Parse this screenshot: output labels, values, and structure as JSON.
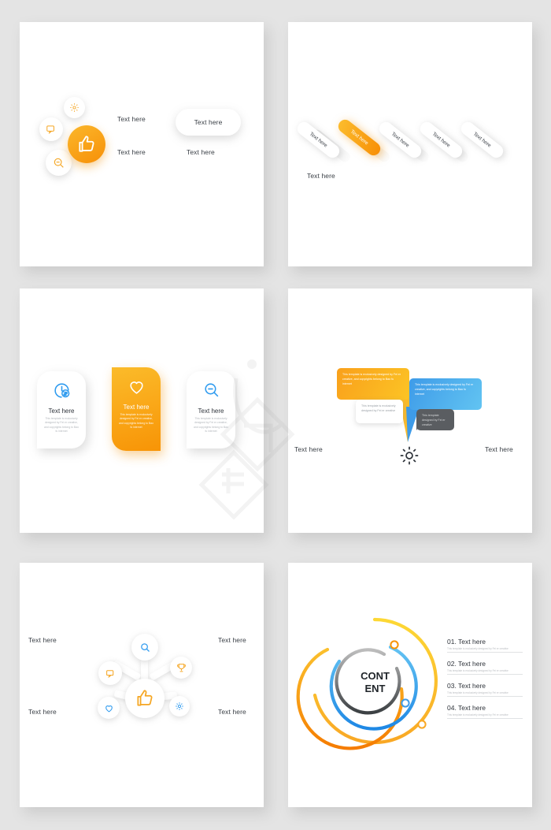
{
  "meta": {
    "background_color": "#e4e4e4",
    "panel_color": "#ffffff",
    "accent_orange": "#F79008",
    "accent_orange_light": "#FBBB2A",
    "accent_blue": "#3E9BE8",
    "accent_blue_light": "#62C4F2",
    "accent_grey": "#5a5d61",
    "text_color": "#3b4047"
  },
  "strings": {
    "text_here": "Text here",
    "body_long": "This template is exclusively designed by Fei er creative, and copyrights belong to Bao fu internet",
    "body_short": "This template is exclusively designed by Fei er creative",
    "body_tiny": "This template designed by Fei er creative",
    "content_line1": "CONT",
    "content_line2": "ENT"
  },
  "panel1": {
    "name": "circle-cluster-infographic",
    "icons": [
      {
        "id": "gear-icon",
        "label": "gear"
      },
      {
        "id": "comment-icon",
        "label": "comment"
      },
      {
        "id": "zoom-out-icon",
        "label": "zoom-out"
      },
      {
        "id": "thumbs-up-icon",
        "label": "thumbs-up"
      }
    ],
    "labels": [
      "Text here",
      "Text here",
      "Text here",
      "Text here"
    ],
    "button_label": "Text here"
  },
  "panel2": {
    "name": "diagonal-pills-infographic",
    "pills": [
      {
        "label": "Text here",
        "active": false
      },
      {
        "label": "Text here",
        "active": true
      },
      {
        "label": "Text here",
        "active": false
      },
      {
        "label": "Text here",
        "active": false
      },
      {
        "label": "Text here",
        "active": false
      }
    ],
    "caption": "Text here"
  },
  "panel3": {
    "name": "leaf-cards-infographic",
    "cards": [
      {
        "icon": "clock-dollar-icon",
        "title": "Text here",
        "body": "This template is exclusively designed by Fei er creative, and copyrights belong to Bao fu internet",
        "active": false
      },
      {
        "icon": "heart-icon",
        "title": "Text here",
        "body": "This template is exclusively designed by Fei er creative, and copyrights belong to Bao fu internet",
        "active": true
      },
      {
        "icon": "zoom-out-icon",
        "title": "Text here",
        "body": "This template is exclusively designed by Fei er creative, and copyrights belong to Bao fu internet",
        "active": false
      }
    ]
  },
  "panel4": {
    "name": "speech-bubbles-infographic",
    "bubbles": [
      {
        "color": "orange",
        "text": "This template is exclusively designed by Fei er creative, and copyrights belong to Bao fu internet"
      },
      {
        "color": "blue",
        "text": "This template is exclusively designed by Fei er creative, and copyrights belong to Bao fu internet"
      },
      {
        "color": "white",
        "text": "This template is exclusively designed by Fei er creative"
      },
      {
        "color": "dark",
        "text": "This template designed by Fei er creative"
      }
    ],
    "center_icon": "gear-icon",
    "label_left": "Text here",
    "label_right": "Text here"
  },
  "panel5": {
    "name": "node-network-infographic",
    "center_icon": "thumbs-up-icon",
    "nodes": [
      {
        "icon": "search-icon",
        "label": "search"
      },
      {
        "icon": "trophy-icon",
        "label": "trophy"
      },
      {
        "icon": "gear-icon",
        "label": "gear"
      },
      {
        "icon": "heart-icon",
        "label": "heart"
      },
      {
        "icon": "comment-icon",
        "label": "comment"
      }
    ],
    "labels": {
      "top_left": "Text here",
      "top_right": "Text here",
      "bottom_left": "Text here",
      "bottom_right": "Text here"
    }
  },
  "panel6": {
    "name": "circular-rings-infographic",
    "center_line1": "CONT",
    "center_line2": "ENT",
    "rings": [
      {
        "color": "#FBC02D",
        "radius": 78,
        "label": "outer-yellow-arc"
      },
      {
        "color": "#F89406",
        "radius": 66,
        "label": "orange-arc"
      },
      {
        "color": "#3E9BE8",
        "radius": 54,
        "label": "blue-arc"
      },
      {
        "color": "#6E7276",
        "radius": 40,
        "label": "grey-arc"
      }
    ],
    "markers": [
      {
        "color": "#F89406",
        "label": "marker-orange-top"
      },
      {
        "color": "#3E9BE8",
        "label": "marker-blue-mid"
      },
      {
        "color": "#F9A825",
        "label": "marker-yellow-bottom"
      }
    ],
    "items": [
      {
        "num": "01.",
        "title": "Text here",
        "sub": "This template is exclusively designed by Fei er creative"
      },
      {
        "num": "02.",
        "title": "Text here",
        "sub": "This template is exclusively designed by Fei er creative"
      },
      {
        "num": "03.",
        "title": "Text here",
        "sub": "This template is exclusively designed by Fei er creative"
      },
      {
        "num": "04.",
        "title": "Text here",
        "sub": "This template is exclusively designed by Fei er creative"
      }
    ]
  }
}
